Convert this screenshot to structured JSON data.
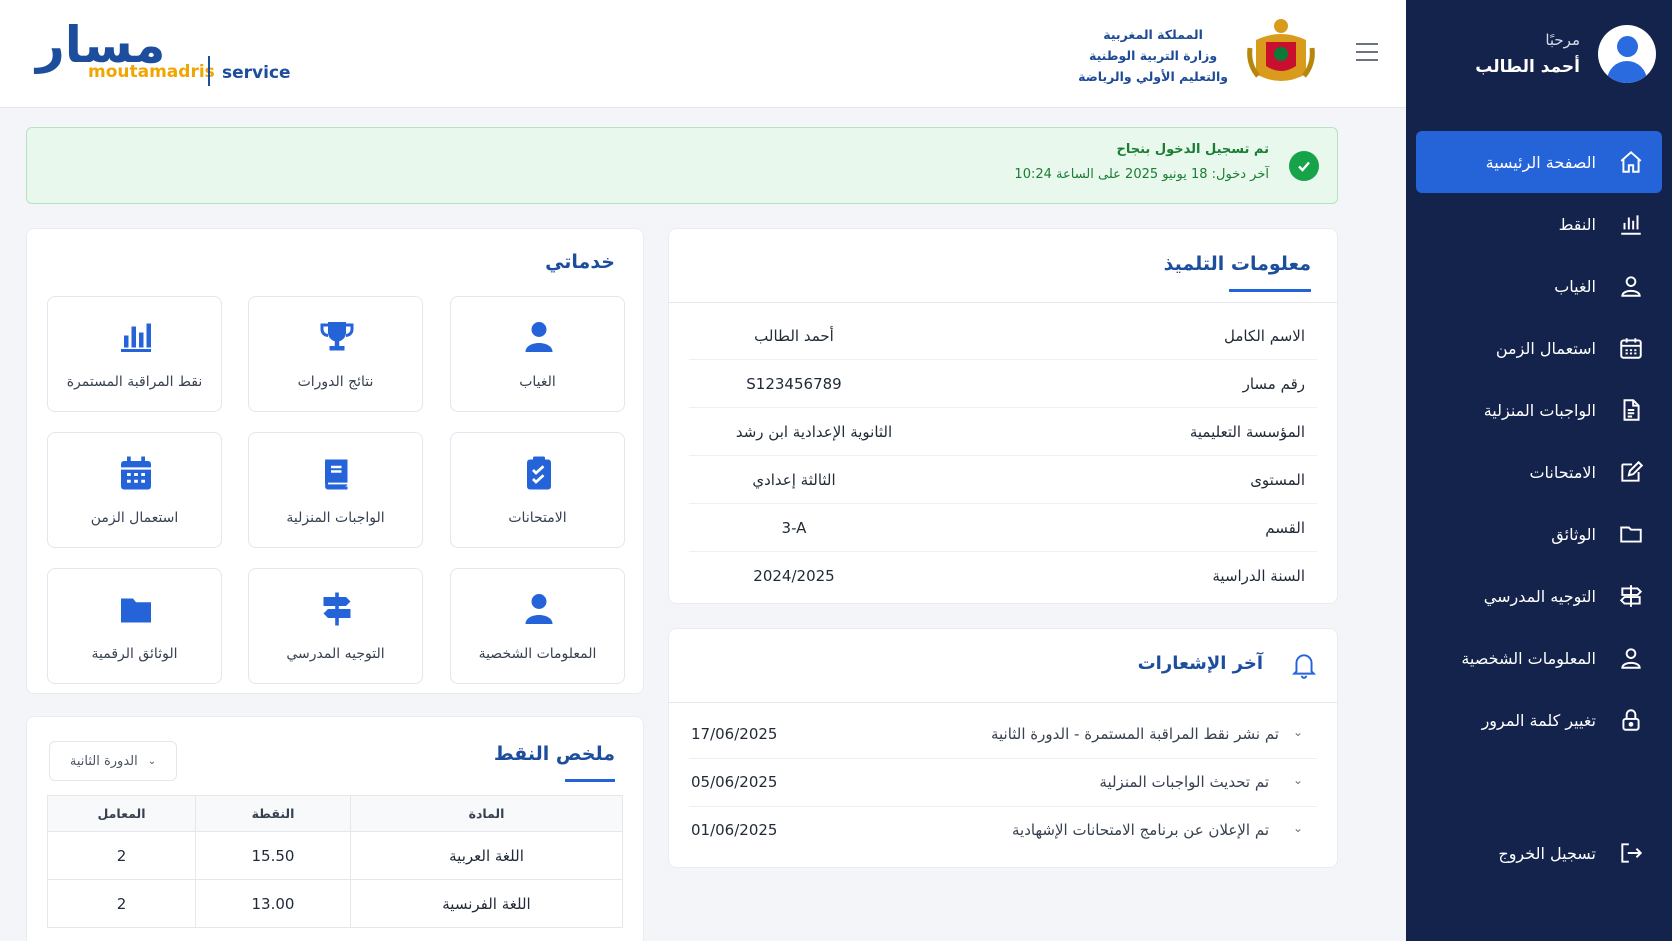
{
  "header": {
    "logo_ar": "مسار",
    "logo_brand": "moutamadris",
    "logo_service": "service",
    "ministry_line1": "المملكة المغربية",
    "ministry_line2": "وزارة التربية الوطنية",
    "ministry_line3": "والتعليم الأولي والرياضة"
  },
  "sidebar": {
    "greeting": "مرحبًا",
    "user_name": "أحمد الطالب",
    "items": [
      {
        "label": "الصفحة الرئيسية",
        "icon": "home-icon",
        "active": true
      },
      {
        "label": "النقط",
        "icon": "bar-chart-icon"
      },
      {
        "label": "الغياب",
        "icon": "user-icon"
      },
      {
        "label": "استعمال الزمن",
        "icon": "calendar-icon"
      },
      {
        "label": "الواجبات المنزلية",
        "icon": "document-icon"
      },
      {
        "label": "الامتحانات",
        "icon": "edit-icon"
      },
      {
        "label": "الوثائق",
        "icon": "folder-icon"
      },
      {
        "label": "التوجيه المدرسي",
        "icon": "signpost-icon"
      },
      {
        "label": "المعلومات الشخصية",
        "icon": "user-icon"
      },
      {
        "label": "تغيير كلمة المرور",
        "icon": "lock-icon"
      }
    ],
    "logout": "تسجيل الخروج"
  },
  "alert": {
    "title": "تم تسجيل الدخول بنجاح",
    "subtitle": "آخر دخول: 18 يونيو 2025 على الساعة 10:24"
  },
  "services": {
    "title": "خدماتي",
    "tiles": [
      {
        "label": "الغياب",
        "icon": "user-icon"
      },
      {
        "label": "نتائج الدورات",
        "icon": "trophy-icon"
      },
      {
        "label": "نقط المراقبة المستمرة",
        "icon": "bar-chart-icon"
      },
      {
        "label": "الامتحانات",
        "icon": "clipboard-check-icon"
      },
      {
        "label": "الواجبات المنزلية",
        "icon": "book-icon"
      },
      {
        "label": "استعمال الزمن",
        "icon": "calendar-icon"
      },
      {
        "label": "المعلومات الشخصية",
        "icon": "user-icon"
      },
      {
        "label": "التوجيه المدرسي",
        "icon": "signpost-icon"
      },
      {
        "label": "الوثائق الرقمية",
        "icon": "folder-icon"
      }
    ]
  },
  "grades": {
    "title": "ملخص النقط",
    "select_value": "الدورة الثانية",
    "columns": [
      "المعامل",
      "النقطة",
      "المادة"
    ],
    "rows": [
      {
        "coef": "2",
        "grade": "15.50",
        "subject": "اللغة العربية"
      },
      {
        "coef": "2",
        "grade": "13.00",
        "subject": "اللغة الفرنسية"
      }
    ]
  },
  "student": {
    "title": "معلومات التلميذ",
    "rows": [
      {
        "label": "الاسم الكامل",
        "value": "أحمد الطالب"
      },
      {
        "label": "رقم مسار",
        "value": "S123456789"
      },
      {
        "label": "المؤسسة التعليمية",
        "value": "الثانوية الإعدادية ابن رشد"
      },
      {
        "label": "المستوى",
        "value": "الثالثة إعدادي"
      },
      {
        "label": "القسم",
        "value": "3-A"
      },
      {
        "label": "السنة الدراسية",
        "value": "2024/2025"
      }
    ]
  },
  "notifications": {
    "title": "آخر الإشعارات",
    "items": [
      {
        "message": "تم نشر نقط المراقبة المستمرة - الدورة الثانية",
        "date": "17/06/2025"
      },
      {
        "message": "تم تحديث الواجبات المنزلية",
        "date": "05/06/2025"
      },
      {
        "message": "تم الإعلان عن برنامج الامتحانات الإشهادية",
        "date": "01/06/2025"
      }
    ]
  },
  "colors": {
    "sidebar": "#14234b",
    "accent": "#2563d9",
    "brand": "#1d4e9e",
    "success": "#16a34a",
    "logo_orange": "#f0a500"
  }
}
